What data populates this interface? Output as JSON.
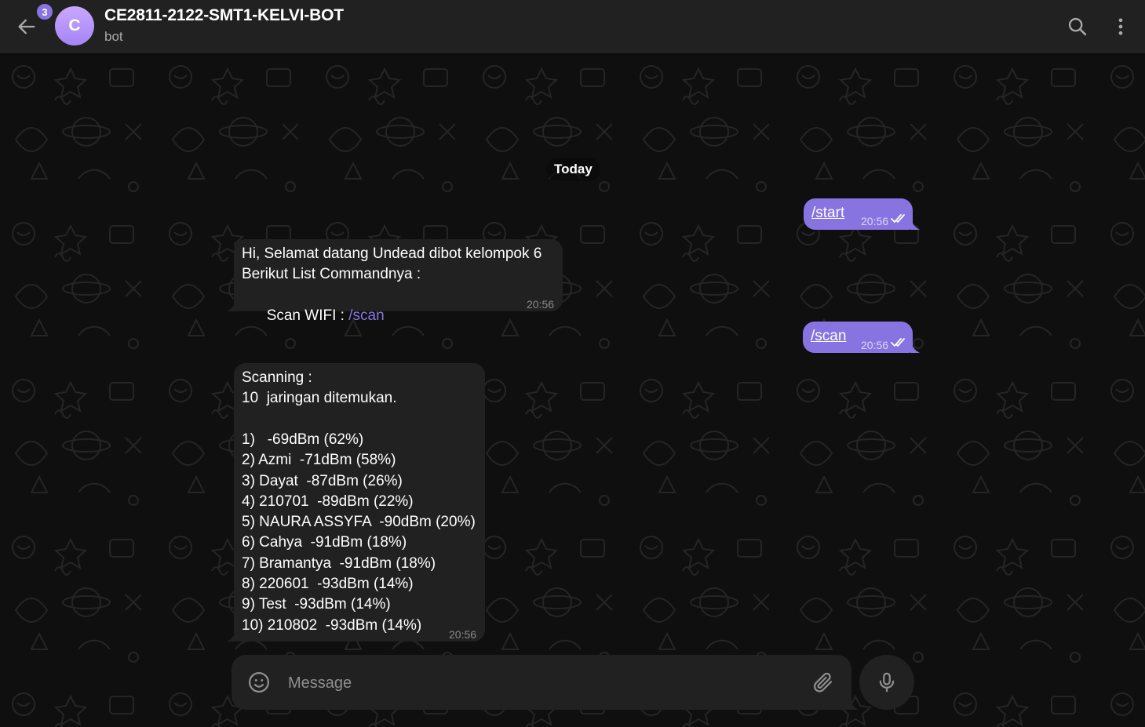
{
  "header": {
    "unread_count": "3",
    "avatar_letter": "C",
    "title": "CE2811-2122-SMT1-KELVI-BOT",
    "subtitle": "bot"
  },
  "date_separator": "Today",
  "messages": [
    {
      "direction": "out",
      "command": "/start",
      "time": "20:56"
    },
    {
      "direction": "in",
      "line1": "Hi, Selamat datang Undead dibot kelompok 6",
      "line2": "Berikut List Commandnya :",
      "line3_prefix": "Scan WIFI : ",
      "line3_link": "/scan",
      "time": "20:56"
    },
    {
      "direction": "out",
      "command": "/scan",
      "time": "20:56"
    },
    {
      "direction": "in",
      "header_line": "Scanning :",
      "count_line": "10  jaringan ditemukan.",
      "networks": [
        "1)   -69dBm (62%)",
        "2) Azmi  -71dBm (58%)",
        "3) Dayat  -87dBm (26%)",
        "4) 210701  -89dBm (22%)",
        "5) NAURA ASSYFA  -90dBm (20%)",
        "6) Cahya  -91dBm (18%)",
        "7) Bramantya  -91dBm (18%)",
        "8) 220601  -93dBm (14%)",
        "9) Test  -93dBm (14%)",
        "10) 210802  -93dBm (14%)"
      ],
      "time": "20:56"
    }
  ],
  "composer": {
    "placeholder": "Message"
  },
  "icons": {
    "back": "arrow-left-icon",
    "search": "search-icon",
    "more": "more-vertical-icon",
    "emoji": "smile-icon",
    "attach": "paperclip-icon",
    "mic": "microphone-icon",
    "read_receipt": "double-check-icon"
  },
  "colors": {
    "accent": "#8774e1",
    "header_bg": "#212121",
    "incoming_bubble": "#212121",
    "outgoing_bubble": "#8774e1",
    "chat_bg": "#0f0f0f"
  }
}
